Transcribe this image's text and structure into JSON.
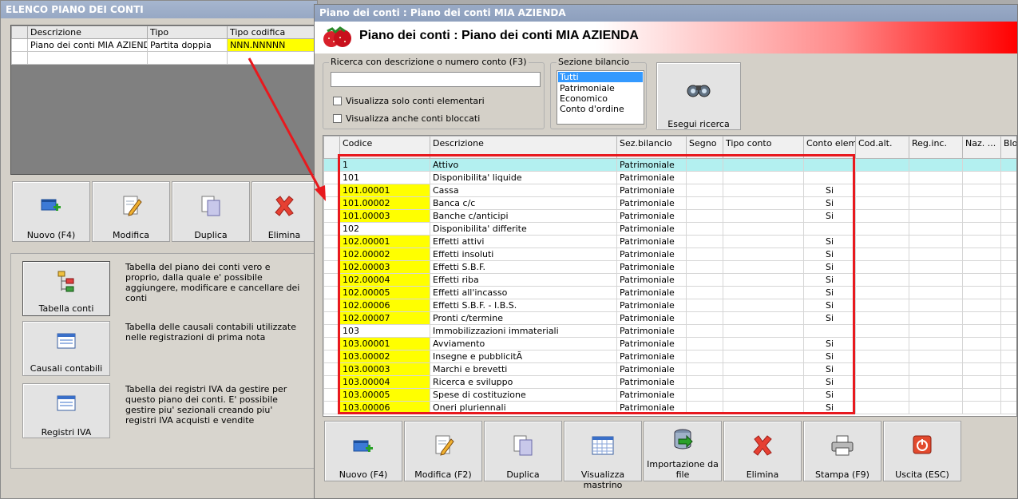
{
  "left": {
    "title": "ELENCO PIANO DEI CONTI",
    "headers": [
      "Descrizione",
      "Tipo",
      "Tipo codifica"
    ],
    "row": {
      "descrizione": "Piano dei conti MIA AZIENDA",
      "tipo": "Partita doppia",
      "codifica": "NNN.NNNNN"
    },
    "buttons": {
      "nuovo": "Nuovo (F4)",
      "modifica": "Modifica",
      "duplica": "Duplica",
      "elimina": "Elimina"
    },
    "panel": {
      "tabella_conti": {
        "label": "Tabella conti",
        "desc": "Tabella del piano dei conti vero e proprio, dalla quale e' possibile aggiungere, modificare e cancellare dei conti"
      },
      "causali": {
        "label": "Causali contabili",
        "desc": "Tabella delle causali contabili utilizzate nelle registrazioni di prima nota"
      },
      "registri": {
        "label": "Registri IVA",
        "desc": "Tabella dei registri IVA da gestire per questo piano dei conti. E' possibile gestire piu' sezionali creando piu' registri IVA acquisti e vendite"
      }
    }
  },
  "right": {
    "title": "Piano dei conti : Piano dei conti MIA AZIENDA",
    "banner_title": "Piano dei conti : Piano dei conti MIA AZIENDA",
    "search": {
      "group_label": "Ricerca con descrizione o numero conto (F3)",
      "value": "",
      "chk_elementari": "Visualizza solo conti elementari",
      "chk_bloccati": "Visualizza anche conti bloccati"
    },
    "sezione": {
      "label": "Sezione bilancio",
      "options": [
        "Tutti",
        "Patrimoniale",
        "Economico",
        "Conto d'ordine"
      ],
      "selected": "Tutti"
    },
    "esegui": "Esegui ricerca",
    "columns": [
      "Codice",
      "Descrizione",
      "Sez.bilancio",
      "Segno",
      "Tipo conto",
      "Conto elem.",
      "Cod.alt.",
      "Reg.inc.",
      "Naz. ...",
      "Bloc"
    ],
    "rows": [
      {
        "codice": "1",
        "descrizione": "Attivo",
        "sez": "Patrimoniale",
        "elem": "",
        "yellow": false,
        "selected": true
      },
      {
        "codice": "101",
        "descrizione": "Disponibilita' liquide",
        "sez": "Patrimoniale",
        "elem": "",
        "yellow": false,
        "selected": false
      },
      {
        "codice": "101.00001",
        "descrizione": "Cassa",
        "sez": "Patrimoniale",
        "elem": "Si",
        "yellow": true,
        "selected": false
      },
      {
        "codice": "101.00002",
        "descrizione": "Banca c/c",
        "sez": "Patrimoniale",
        "elem": "Si",
        "yellow": true,
        "selected": false
      },
      {
        "codice": "101.00003",
        "descrizione": "Banche c/anticipi",
        "sez": "Patrimoniale",
        "elem": "Si",
        "yellow": true,
        "selected": false
      },
      {
        "codice": "102",
        "descrizione": "Disponibilita' differite",
        "sez": "Patrimoniale",
        "elem": "",
        "yellow": false,
        "selected": false
      },
      {
        "codice": "102.00001",
        "descrizione": "Effetti attivi",
        "sez": "Patrimoniale",
        "elem": "Si",
        "yellow": true,
        "selected": false
      },
      {
        "codice": "102.00002",
        "descrizione": "Effetti insoluti",
        "sez": "Patrimoniale",
        "elem": "Si",
        "yellow": true,
        "selected": false
      },
      {
        "codice": "102.00003",
        "descrizione": "Effetti S.B.F.",
        "sez": "Patrimoniale",
        "elem": "Si",
        "yellow": true,
        "selected": false
      },
      {
        "codice": "102.00004",
        "descrizione": "Effetti riba",
        "sez": "Patrimoniale",
        "elem": "Si",
        "yellow": true,
        "selected": false
      },
      {
        "codice": "102.00005",
        "descrizione": "Effetti all'incasso",
        "sez": "Patrimoniale",
        "elem": "Si",
        "yellow": true,
        "selected": false
      },
      {
        "codice": "102.00006",
        "descrizione": "Effetti S.B.F. - I.B.S.",
        "sez": "Patrimoniale",
        "elem": "Si",
        "yellow": true,
        "selected": false
      },
      {
        "codice": "102.00007",
        "descrizione": "Pronti c/termine",
        "sez": "Patrimoniale",
        "elem": "Si",
        "yellow": true,
        "selected": false
      },
      {
        "codice": "103",
        "descrizione": "Immobilizzazioni immateriali",
        "sez": "Patrimoniale",
        "elem": "",
        "yellow": false,
        "selected": false
      },
      {
        "codice": "103.00001",
        "descrizione": "Avviamento",
        "sez": "Patrimoniale",
        "elem": "Si",
        "yellow": true,
        "selected": false
      },
      {
        "codice": "103.00002",
        "descrizione": "Insegne e pubblicitÃ",
        "sez": "Patrimoniale",
        "elem": "Si",
        "yellow": true,
        "selected": false
      },
      {
        "codice": "103.00003",
        "descrizione": "Marchi e brevetti",
        "sez": "Patrimoniale",
        "elem": "Si",
        "yellow": true,
        "selected": false
      },
      {
        "codice": "103.00004",
        "descrizione": "Ricerca e sviluppo",
        "sez": "Patrimoniale",
        "elem": "Si",
        "yellow": true,
        "selected": false
      },
      {
        "codice": "103.00005",
        "descrizione": "Spese di costituzione",
        "sez": "Patrimoniale",
        "elem": "Si",
        "yellow": true,
        "selected": false
      },
      {
        "codice": "103.00006",
        "descrizione": "Oneri pluriennali",
        "sez": "Patrimoniale",
        "elem": "Si",
        "yellow": true,
        "selected": false
      }
    ],
    "buttons": {
      "nuovo": "Nuovo (F4)",
      "modifica": "Modifica (F2)",
      "duplica": "Duplica",
      "mastrino": "Visualizza mastrino",
      "importazione": "Importazione da file",
      "elimina": "Elimina",
      "stampa": "Stampa (F9)",
      "uscita": "Uscita (ESC)"
    }
  },
  "colors": {
    "highlight": "#e8191e",
    "yellow": "#ffff00",
    "selected_row": "#b3f0f0"
  }
}
